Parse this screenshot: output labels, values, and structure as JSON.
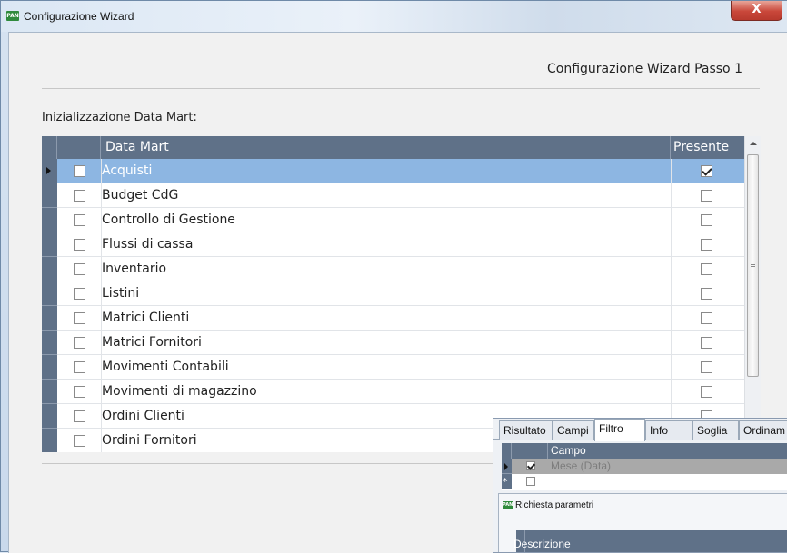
{
  "window": {
    "title": "Configurazione Wizard",
    "app_icon": "PAN",
    "close_glyph": "X"
  },
  "wizard": {
    "step_title": "Configurazione Wizard Passo 1",
    "section_label": "Inizializzazione Data Mart:"
  },
  "grid": {
    "columns": [
      "Data Mart",
      "Presente"
    ],
    "rows": [
      {
        "label": "Acquisti",
        "selected": true,
        "checked": false,
        "presente": true
      },
      {
        "label": "Budget CdG",
        "selected": false,
        "checked": false,
        "presente": false
      },
      {
        "label": "Controllo di Gestione",
        "selected": false,
        "checked": false,
        "presente": false
      },
      {
        "label": "Flussi di cassa",
        "selected": false,
        "checked": false,
        "presente": false
      },
      {
        "label": "Inventario",
        "selected": false,
        "checked": false,
        "presente": false
      },
      {
        "label": "Listini",
        "selected": false,
        "checked": false,
        "presente": false
      },
      {
        "label": "Matrici Clienti",
        "selected": false,
        "checked": false,
        "presente": false
      },
      {
        "label": "Matrici Fornitori",
        "selected": false,
        "checked": false,
        "presente": false
      },
      {
        "label": "Movimenti Contabili",
        "selected": false,
        "checked": false,
        "presente": false
      },
      {
        "label": "Movimenti di magazzino",
        "selected": false,
        "checked": false,
        "presente": false
      },
      {
        "label": "Ordini Clienti",
        "selected": false,
        "checked": false,
        "presente": false
      },
      {
        "label": "Ordini Fornitori",
        "selected": false,
        "checked": false,
        "presente": false
      }
    ]
  },
  "overlay": {
    "tabs": [
      "Risultato",
      "Campi",
      "Filtro",
      "Info",
      "Soglia",
      "Ordinam"
    ],
    "active_tab": "Filtro",
    "grid_header": "Campo",
    "rows": [
      {
        "label": "Mese (Data)",
        "checked": true
      },
      {
        "label": "",
        "checked": false
      }
    ],
    "new_row_marker": "*",
    "subwindow": {
      "icon": "PAN",
      "title": "Richiesta parametri",
      "column": "Descrizione"
    }
  },
  "colors": {
    "grid_header": "#5f7188",
    "selection": "#8db6e2",
    "close_button": "#c9473a"
  }
}
